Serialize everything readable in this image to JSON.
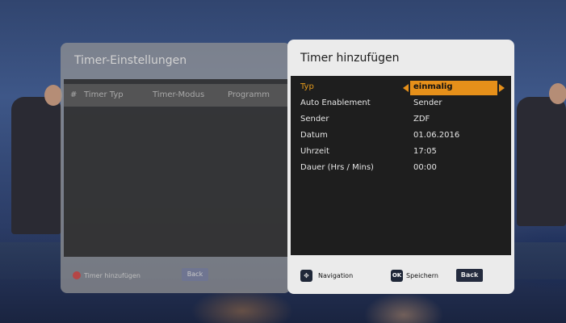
{
  "left_dialog": {
    "title": "Timer-Einstellungen",
    "columns": [
      "#",
      "Timer Typ",
      "Timer-Modus",
      "Programm"
    ],
    "footer": {
      "add_label": "Timer hinzufügen",
      "back_label": "Back"
    }
  },
  "right_dialog": {
    "title": "Timer hinzufügen",
    "rows": [
      {
        "label": "Typ",
        "value": "einmalig"
      },
      {
        "label": "Auto Enablement",
        "value": "Sender"
      },
      {
        "label": "Sender",
        "value": "ZDF"
      },
      {
        "label": "Datum",
        "value": "01.06.2016"
      },
      {
        "label": "Uhrzeit",
        "value": "17:05"
      },
      {
        "label": "Dauer (Hrs / Mins)",
        "value": "00:00"
      }
    ],
    "footer": {
      "nav_label": "Navigation",
      "ok_label": "OK",
      "save_label": "Speichern",
      "back_label": "Back"
    }
  },
  "colors": {
    "accent": "#e6901a",
    "red_key": "#b54646"
  }
}
